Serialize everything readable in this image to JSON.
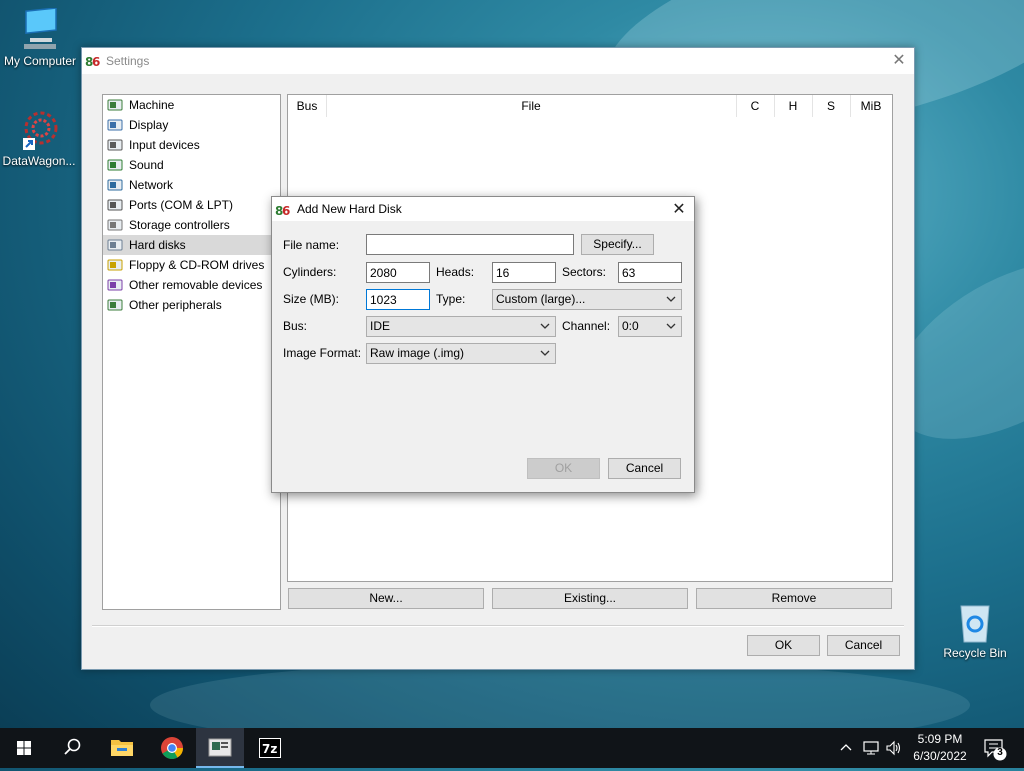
{
  "desktop": {
    "icons": [
      {
        "label": "My Computer"
      },
      {
        "label": "DataWagon..."
      },
      {
        "label": "Recycle Bin"
      }
    ]
  },
  "settings": {
    "title": "Settings",
    "tree": [
      {
        "label": "Machine",
        "icon": "machine-icon"
      },
      {
        "label": "Display",
        "icon": "display-icon"
      },
      {
        "label": "Input devices",
        "icon": "input-devices-icon"
      },
      {
        "label": "Sound",
        "icon": "sound-icon"
      },
      {
        "label": "Network",
        "icon": "network-icon"
      },
      {
        "label": "Ports (COM & LPT)",
        "icon": "ports-icon"
      },
      {
        "label": "Storage controllers",
        "icon": "storage-icon"
      },
      {
        "label": "Hard disks",
        "icon": "hard-disk-icon",
        "selected": true
      },
      {
        "label": "Floppy & CD-ROM drives",
        "icon": "floppy-icon"
      },
      {
        "label": "Other removable devices",
        "icon": "removable-icon"
      },
      {
        "label": "Other peripherals",
        "icon": "peripherals-icon"
      }
    ],
    "columns": [
      "Bus",
      "File",
      "C",
      "H",
      "S",
      "MiB"
    ],
    "buttons": {
      "new": "New...",
      "existing": "Existing...",
      "remove": "Remove",
      "ok": "OK",
      "cancel": "Cancel"
    }
  },
  "dialog": {
    "title": "Add New Hard Disk",
    "file_name_label": "File name:",
    "file_name_value": "",
    "specify": "Specify...",
    "cylinders_label": "Cylinders:",
    "cylinders": "2080",
    "heads_label": "Heads:",
    "heads": "16",
    "sectors_label": "Sectors:",
    "sectors": "63",
    "size_label": "Size (MB):",
    "size": "1023",
    "type_label": "Type:",
    "type": "Custom (large)...",
    "bus_label": "Bus:",
    "bus": "IDE",
    "channel_label": "Channel:",
    "channel": "0:0",
    "image_format_label": "Image Format:",
    "image_format": "Raw image (.img)",
    "ok": "OK",
    "cancel": "Cancel"
  },
  "taskbar": {
    "time": "5:09 PM",
    "date": "6/30/2022",
    "notification_count": "3",
    "apps": [
      "start-icon",
      "search-icon",
      "file-explorer-icon",
      "chrome-icon",
      "86box-icon",
      "7zip-icon"
    ]
  }
}
